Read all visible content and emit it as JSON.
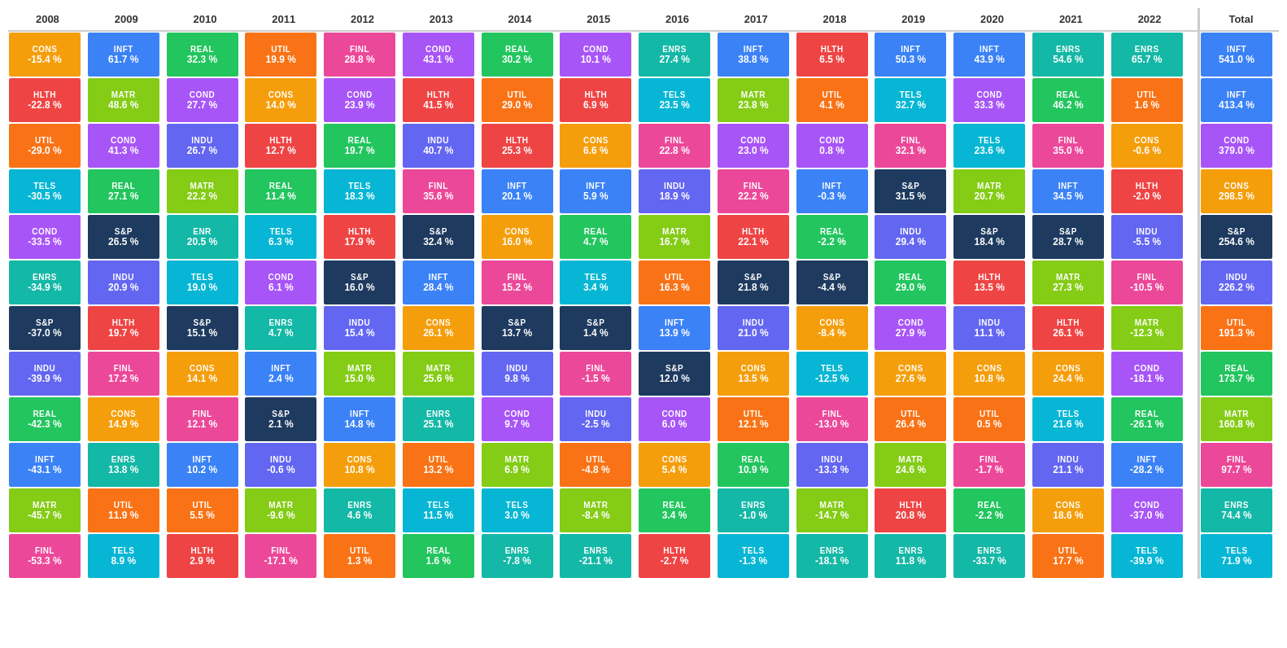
{
  "headers": [
    "2008",
    "2009",
    "2010",
    "2011",
    "2012",
    "2013",
    "2014",
    "2015",
    "2016",
    "2017",
    "2018",
    "2019",
    "2020",
    "2021",
    "2022",
    "",
    "Total"
  ],
  "colors": {
    "CONS": "#f59e0b",
    "HLTH": "#ef4444",
    "UTIL": "#f97316",
    "TELS": "#06b6d4",
    "COND": "#a855f7",
    "ENRS": "#14b8a6",
    "S&P": "#1e3a5f",
    "INDU": "#6366f1",
    "REAL": "#22c55e",
    "INFT": "#3b82f6",
    "FINL": "#ec4899",
    "MATR": "#84cc16",
    "MATS": "#84cc16"
  },
  "rows": [
    [
      {
        "t": "CONS",
        "v": "-15.4 %",
        "c": "#f59e0b"
      },
      {
        "t": "INFT",
        "v": "61.7 %",
        "c": "#3b82f6"
      },
      {
        "t": "REAL",
        "v": "32.3 %",
        "c": "#22c55e"
      },
      {
        "t": "UTIL",
        "v": "19.9 %",
        "c": "#f97316"
      },
      {
        "t": "FINL",
        "v": "28.8 %",
        "c": "#ec4899"
      },
      {
        "t": "COND",
        "v": "43.1 %",
        "c": "#a855f7"
      },
      {
        "t": "REAL",
        "v": "30.2 %",
        "c": "#22c55e"
      },
      {
        "t": "COND",
        "v": "10.1 %",
        "c": "#a855f7"
      },
      {
        "t": "ENRS",
        "v": "27.4 %",
        "c": "#14b8a6"
      },
      {
        "t": "INFT",
        "v": "38.8 %",
        "c": "#3b82f6"
      },
      {
        "t": "HLTH",
        "v": "6.5 %",
        "c": "#ef4444"
      },
      {
        "t": "INFT",
        "v": "50.3 %",
        "c": "#3b82f6"
      },
      {
        "t": "INFT",
        "v": "43.9 %",
        "c": "#3b82f6"
      },
      {
        "t": "ENRS",
        "v": "54.6 %",
        "c": "#14b8a6"
      },
      {
        "t": "ENRS",
        "v": "65.7 %",
        "c": "#14b8a6"
      },
      {
        "t": "",
        "v": "",
        "c": "#fff"
      },
      {
        "t": "INFT",
        "v": "541.0 %",
        "c": "#3b82f6"
      }
    ],
    [
      {
        "t": "HLTH",
        "v": "-22.8 %",
        "c": "#ef4444"
      },
      {
        "t": "MATR",
        "v": "48.6 %",
        "c": "#84cc16"
      },
      {
        "t": "COND",
        "v": "27.7 %",
        "c": "#a855f7"
      },
      {
        "t": "CONS",
        "v": "14.0 %",
        "c": "#f59e0b"
      },
      {
        "t": "COND",
        "v": "23.9 %",
        "c": "#a855f7"
      },
      {
        "t": "HLTH",
        "v": "41.5 %",
        "c": "#ef4444"
      },
      {
        "t": "UTIL",
        "v": "29.0 %",
        "c": "#f97316"
      },
      {
        "t": "HLTH",
        "v": "6.9 %",
        "c": "#ef4444"
      },
      {
        "t": "TELS",
        "v": "23.5 %",
        "c": "#06b6d4"
      },
      {
        "t": "MATR",
        "v": "23.8 %",
        "c": "#84cc16"
      },
      {
        "t": "UTIL",
        "v": "4.1 %",
        "c": "#f97316"
      },
      {
        "t": "TELS",
        "v": "32.7 %",
        "c": "#06b6d4"
      },
      {
        "t": "COND",
        "v": "33.3 %",
        "c": "#a855f7"
      },
      {
        "t": "REAL",
        "v": "46.2 %",
        "c": "#22c55e"
      },
      {
        "t": "UTIL",
        "v": "1.6 %",
        "c": "#f97316"
      },
      {
        "t": "",
        "v": "",
        "c": "#fff"
      },
      {
        "t": "INFT",
        "v": "413.4 %",
        "c": "#3b82f6"
      }
    ],
    [
      {
        "t": "UTIL",
        "v": "-29.0 %",
        "c": "#f97316"
      },
      {
        "t": "COND",
        "v": "41.3 %",
        "c": "#a855f7"
      },
      {
        "t": "INDU",
        "v": "26.7 %",
        "c": "#6366f1"
      },
      {
        "t": "HLTH",
        "v": "12.7 %",
        "c": "#ef4444"
      },
      {
        "t": "REAL",
        "v": "19.7 %",
        "c": "#22c55e"
      },
      {
        "t": "INDU",
        "v": "40.7 %",
        "c": "#6366f1"
      },
      {
        "t": "HLTH",
        "v": "25.3 %",
        "c": "#ef4444"
      },
      {
        "t": "CONS",
        "v": "6.6 %",
        "c": "#f59e0b"
      },
      {
        "t": "FINL",
        "v": "22.8 %",
        "c": "#ec4899"
      },
      {
        "t": "COND",
        "v": "23.0 %",
        "c": "#a855f7"
      },
      {
        "t": "COND",
        "v": "0.8 %",
        "c": "#a855f7"
      },
      {
        "t": "FINL",
        "v": "32.1 %",
        "c": "#ec4899"
      },
      {
        "t": "TELS",
        "v": "23.6 %",
        "c": "#06b6d4"
      },
      {
        "t": "FINL",
        "v": "35.0 %",
        "c": "#ec4899"
      },
      {
        "t": "CONS",
        "v": "-0.6 %",
        "c": "#f59e0b"
      },
      {
        "t": "",
        "v": "",
        "c": "#fff"
      },
      {
        "t": "COND",
        "v": "379.0 %",
        "c": "#a855f7"
      }
    ],
    [
      {
        "t": "TELS",
        "v": "-30.5 %",
        "c": "#06b6d4"
      },
      {
        "t": "REAL",
        "v": "27.1 %",
        "c": "#22c55e"
      },
      {
        "t": "MATR",
        "v": "22.2 %",
        "c": "#84cc16"
      },
      {
        "t": "REAL",
        "v": "11.4 %",
        "c": "#22c55e"
      },
      {
        "t": "TELS",
        "v": "18.3 %",
        "c": "#06b6d4"
      },
      {
        "t": "FINL",
        "v": "35.6 %",
        "c": "#ec4899"
      },
      {
        "t": "INFT",
        "v": "20.1 %",
        "c": "#3b82f6"
      },
      {
        "t": "INFT",
        "v": "5.9 %",
        "c": "#3b82f6"
      },
      {
        "t": "INDU",
        "v": "18.9 %",
        "c": "#6366f1"
      },
      {
        "t": "FINL",
        "v": "22.2 %",
        "c": "#ec4899"
      },
      {
        "t": "INFT",
        "v": "-0.3 %",
        "c": "#3b82f6"
      },
      {
        "t": "S&P",
        "v": "31.5 %",
        "c": "#1e3a5f"
      },
      {
        "t": "MATR",
        "v": "20.7 %",
        "c": "#84cc16"
      },
      {
        "t": "INFT",
        "v": "34.5 %",
        "c": "#3b82f6"
      },
      {
        "t": "HLTH",
        "v": "-2.0 %",
        "c": "#ef4444"
      },
      {
        "t": "",
        "v": "",
        "c": "#fff"
      },
      {
        "t": "CONS",
        "v": "298.5 %",
        "c": "#f59e0b"
      }
    ],
    [
      {
        "t": "COND",
        "v": "-33.5 %",
        "c": "#a855f7"
      },
      {
        "t": "S&P",
        "v": "26.5 %",
        "c": "#1e3a5f"
      },
      {
        "t": "ENR",
        "v": "20.5 %",
        "c": "#14b8a6"
      },
      {
        "t": "TELS",
        "v": "6.3 %",
        "c": "#06b6d4"
      },
      {
        "t": "HLTH",
        "v": "17.9 %",
        "c": "#ef4444"
      },
      {
        "t": "S&P",
        "v": "32.4 %",
        "c": "#1e3a5f"
      },
      {
        "t": "CONS",
        "v": "16.0 %",
        "c": "#f59e0b"
      },
      {
        "t": "REAL",
        "v": "4.7 %",
        "c": "#22c55e"
      },
      {
        "t": "MATR",
        "v": "16.7 %",
        "c": "#84cc16"
      },
      {
        "t": "HLTH",
        "v": "22.1 %",
        "c": "#ef4444"
      },
      {
        "t": "REAL",
        "v": "-2.2 %",
        "c": "#22c55e"
      },
      {
        "t": "INDU",
        "v": "29.4 %",
        "c": "#6366f1"
      },
      {
        "t": "S&P",
        "v": "18.4 %",
        "c": "#1e3a5f"
      },
      {
        "t": "S&P",
        "v": "28.7 %",
        "c": "#1e3a5f"
      },
      {
        "t": "INDU",
        "v": "-5.5 %",
        "c": "#6366f1"
      },
      {
        "t": "",
        "v": "",
        "c": "#fff"
      },
      {
        "t": "S&P",
        "v": "254.6 %",
        "c": "#1e3a5f"
      }
    ],
    [
      {
        "t": "ENRS",
        "v": "-34.9 %",
        "c": "#14b8a6"
      },
      {
        "t": "INDU",
        "v": "20.9 %",
        "c": "#6366f1"
      },
      {
        "t": "TELS",
        "v": "19.0 %",
        "c": "#06b6d4"
      },
      {
        "t": "COND",
        "v": "6.1 %",
        "c": "#a855f7"
      },
      {
        "t": "S&P",
        "v": "16.0 %",
        "c": "#1e3a5f"
      },
      {
        "t": "INFT",
        "v": "28.4 %",
        "c": "#3b82f6"
      },
      {
        "t": "FINL",
        "v": "15.2 %",
        "c": "#ec4899"
      },
      {
        "t": "TELS",
        "v": "3.4 %",
        "c": "#06b6d4"
      },
      {
        "t": "UTIL",
        "v": "16.3 %",
        "c": "#f97316"
      },
      {
        "t": "S&P",
        "v": "21.8 %",
        "c": "#1e3a5f"
      },
      {
        "t": "S&P",
        "v": "-4.4 %",
        "c": "#1e3a5f"
      },
      {
        "t": "REAL",
        "v": "29.0 %",
        "c": "#22c55e"
      },
      {
        "t": "HLTH",
        "v": "13.5 %",
        "c": "#ef4444"
      },
      {
        "t": "MATR",
        "v": "27.3 %",
        "c": "#84cc16"
      },
      {
        "t": "FINL",
        "v": "-10.5 %",
        "c": "#ec4899"
      },
      {
        "t": "",
        "v": "",
        "c": "#fff"
      },
      {
        "t": "INDU",
        "v": "226.2 %",
        "c": "#6366f1"
      }
    ],
    [
      {
        "t": "S&P",
        "v": "-37.0 %",
        "c": "#1e3a5f"
      },
      {
        "t": "HLTH",
        "v": "19.7 %",
        "c": "#ef4444"
      },
      {
        "t": "S&P",
        "v": "15.1 %",
        "c": "#1e3a5f"
      },
      {
        "t": "ENRS",
        "v": "4.7 %",
        "c": "#14b8a6"
      },
      {
        "t": "INDU",
        "v": "15.4 %",
        "c": "#6366f1"
      },
      {
        "t": "CONS",
        "v": "26.1 %",
        "c": "#f59e0b"
      },
      {
        "t": "S&P",
        "v": "13.7 %",
        "c": "#1e3a5f"
      },
      {
        "t": "S&P",
        "v": "1.4 %",
        "c": "#1e3a5f"
      },
      {
        "t": "INFT",
        "v": "13.9 %",
        "c": "#3b82f6"
      },
      {
        "t": "INDU",
        "v": "21.0 %",
        "c": "#6366f1"
      },
      {
        "t": "CONS",
        "v": "-8.4 %",
        "c": "#f59e0b"
      },
      {
        "t": "COND",
        "v": "27.9 %",
        "c": "#a855f7"
      },
      {
        "t": "INDU",
        "v": "11.1 %",
        "c": "#6366f1"
      },
      {
        "t": "HLTH",
        "v": "26.1 %",
        "c": "#ef4444"
      },
      {
        "t": "MATR",
        "v": "-12.3 %",
        "c": "#84cc16"
      },
      {
        "t": "",
        "v": "",
        "c": "#fff"
      },
      {
        "t": "UTIL",
        "v": "191.3 %",
        "c": "#f97316"
      }
    ],
    [
      {
        "t": "INDU",
        "v": "-39.9 %",
        "c": "#6366f1"
      },
      {
        "t": "FINL",
        "v": "17.2 %",
        "c": "#ec4899"
      },
      {
        "t": "CONS",
        "v": "14.1 %",
        "c": "#f59e0b"
      },
      {
        "t": "INFT",
        "v": "2.4 %",
        "c": "#3b82f6"
      },
      {
        "t": "MATR",
        "v": "15.0 %",
        "c": "#84cc16"
      },
      {
        "t": "MATR",
        "v": "25.6 %",
        "c": "#84cc16"
      },
      {
        "t": "INDU",
        "v": "9.8 %",
        "c": "#6366f1"
      },
      {
        "t": "FINL",
        "v": "-1.5 %",
        "c": "#ec4899"
      },
      {
        "t": "S&P",
        "v": "12.0 %",
        "c": "#1e3a5f"
      },
      {
        "t": "CONS",
        "v": "13.5 %",
        "c": "#f59e0b"
      },
      {
        "t": "TELS",
        "v": "-12.5 %",
        "c": "#06b6d4"
      },
      {
        "t": "CONS",
        "v": "27.6 %",
        "c": "#f59e0b"
      },
      {
        "t": "CONS",
        "v": "10.8 %",
        "c": "#f59e0b"
      },
      {
        "t": "CONS",
        "v": "24.4 %",
        "c": "#f59e0b"
      },
      {
        "t": "COND",
        "v": "-18.1 %",
        "c": "#a855f7"
      },
      {
        "t": "",
        "v": "",
        "c": "#fff"
      },
      {
        "t": "REAL",
        "v": "173.7 %",
        "c": "#22c55e"
      }
    ],
    [
      {
        "t": "REAL",
        "v": "-42.3 %",
        "c": "#22c55e"
      },
      {
        "t": "CONS",
        "v": "14.9 %",
        "c": "#f59e0b"
      },
      {
        "t": "FINL",
        "v": "12.1 %",
        "c": "#ec4899"
      },
      {
        "t": "S&P",
        "v": "2.1 %",
        "c": "#1e3a5f"
      },
      {
        "t": "INFT",
        "v": "14.8 %",
        "c": "#3b82f6"
      },
      {
        "t": "ENRS",
        "v": "25.1 %",
        "c": "#14b8a6"
      },
      {
        "t": "COND",
        "v": "9.7 %",
        "c": "#a855f7"
      },
      {
        "t": "INDU",
        "v": "-2.5 %",
        "c": "#6366f1"
      },
      {
        "t": "COND",
        "v": "6.0 %",
        "c": "#a855f7"
      },
      {
        "t": "UTIL",
        "v": "12.1 %",
        "c": "#f97316"
      },
      {
        "t": "FINL",
        "v": "-13.0 %",
        "c": "#ec4899"
      },
      {
        "t": "UTIL",
        "v": "26.4 %",
        "c": "#f97316"
      },
      {
        "t": "UTIL",
        "v": "0.5 %",
        "c": "#f97316"
      },
      {
        "t": "TELS",
        "v": "21.6 %",
        "c": "#06b6d4"
      },
      {
        "t": "REAL",
        "v": "-26.1 %",
        "c": "#22c55e"
      },
      {
        "t": "",
        "v": "",
        "c": "#fff"
      },
      {
        "t": "MATR",
        "v": "160.8 %",
        "c": "#84cc16"
      }
    ],
    [
      {
        "t": "INFT",
        "v": "-43.1 %",
        "c": "#3b82f6"
      },
      {
        "t": "ENRS",
        "v": "13.8 %",
        "c": "#14b8a6"
      },
      {
        "t": "INFT",
        "v": "10.2 %",
        "c": "#3b82f6"
      },
      {
        "t": "INDU",
        "v": "-0.6 %",
        "c": "#6366f1"
      },
      {
        "t": "CONS",
        "v": "10.8 %",
        "c": "#f59e0b"
      },
      {
        "t": "UTIL",
        "v": "13.2 %",
        "c": "#f97316"
      },
      {
        "t": "MATR",
        "v": "6.9 %",
        "c": "#84cc16"
      },
      {
        "t": "UTIL",
        "v": "-4.8 %",
        "c": "#f97316"
      },
      {
        "t": "CONS",
        "v": "5.4 %",
        "c": "#f59e0b"
      },
      {
        "t": "REAL",
        "v": "10.9 %",
        "c": "#22c55e"
      },
      {
        "t": "INDU",
        "v": "-13.3 %",
        "c": "#6366f1"
      },
      {
        "t": "MATR",
        "v": "24.6 %",
        "c": "#84cc16"
      },
      {
        "t": "FINL",
        "v": "-1.7 %",
        "c": "#ec4899"
      },
      {
        "t": "INDU",
        "v": "21.1 %",
        "c": "#6366f1"
      },
      {
        "t": "INFT",
        "v": "-28.2 %",
        "c": "#3b82f6"
      },
      {
        "t": "",
        "v": "",
        "c": "#fff"
      },
      {
        "t": "FINL",
        "v": "97.7 %",
        "c": "#ec4899"
      }
    ],
    [
      {
        "t": "MATR",
        "v": "-45.7 %",
        "c": "#84cc16"
      },
      {
        "t": "UTIL",
        "v": "11.9 %",
        "c": "#f97316"
      },
      {
        "t": "UTIL",
        "v": "5.5 %",
        "c": "#f97316"
      },
      {
        "t": "MATR",
        "v": "-9.6 %",
        "c": "#84cc16"
      },
      {
        "t": "ENRS",
        "v": "4.6 %",
        "c": "#14b8a6"
      },
      {
        "t": "TELS",
        "v": "11.5 %",
        "c": "#06b6d4"
      },
      {
        "t": "TELS",
        "v": "3.0 %",
        "c": "#06b6d4"
      },
      {
        "t": "MATR",
        "v": "-8.4 %",
        "c": "#84cc16"
      },
      {
        "t": "REAL",
        "v": "3.4 %",
        "c": "#22c55e"
      },
      {
        "t": "ENRS",
        "v": "-1.0 %",
        "c": "#14b8a6"
      },
      {
        "t": "MATR",
        "v": "-14.7 %",
        "c": "#84cc16"
      },
      {
        "t": "HLTH",
        "v": "20.8 %",
        "c": "#ef4444"
      },
      {
        "t": "REAL",
        "v": "-2.2 %",
        "c": "#22c55e"
      },
      {
        "t": "CONS",
        "v": "18.6 %",
        "c": "#f59e0b"
      },
      {
        "t": "COND",
        "v": "-37.0 %",
        "c": "#a855f7"
      },
      {
        "t": "",
        "v": "",
        "c": "#fff"
      },
      {
        "t": "ENRS",
        "v": "74.4 %",
        "c": "#14b8a6"
      }
    ],
    [
      {
        "t": "FINL",
        "v": "-53.3 %",
        "c": "#ec4899"
      },
      {
        "t": "TELS",
        "v": "8.9 %",
        "c": "#06b6d4"
      },
      {
        "t": "HLTH",
        "v": "2.9 %",
        "c": "#ef4444"
      },
      {
        "t": "FINL",
        "v": "-17.1 %",
        "c": "#ec4899"
      },
      {
        "t": "UTIL",
        "v": "1.3 %",
        "c": "#f97316"
      },
      {
        "t": "REAL",
        "v": "1.6 %",
        "c": "#22c55e"
      },
      {
        "t": "ENRS",
        "v": "-7.8 %",
        "c": "#14b8a6"
      },
      {
        "t": "ENRS",
        "v": "-21.1 %",
        "c": "#14b8a6"
      },
      {
        "t": "HLTH",
        "v": "-2.7 %",
        "c": "#ef4444"
      },
      {
        "t": "TELS",
        "v": "-1.3 %",
        "c": "#06b6d4"
      },
      {
        "t": "ENRS",
        "v": "-18.1 %",
        "c": "#14b8a6"
      },
      {
        "t": "ENRS",
        "v": "11.8 %",
        "c": "#14b8a6"
      },
      {
        "t": "ENRS",
        "v": "-33.7 %",
        "c": "#14b8a6"
      },
      {
        "t": "UTIL",
        "v": "17.7 %",
        "c": "#f97316"
      },
      {
        "t": "TELS",
        "v": "-39.9 %",
        "c": "#06b6d4"
      },
      {
        "t": "",
        "v": "",
        "c": "#fff"
      },
      {
        "t": "TELS",
        "v": "71.9 %",
        "c": "#06b6d4"
      }
    ]
  ]
}
